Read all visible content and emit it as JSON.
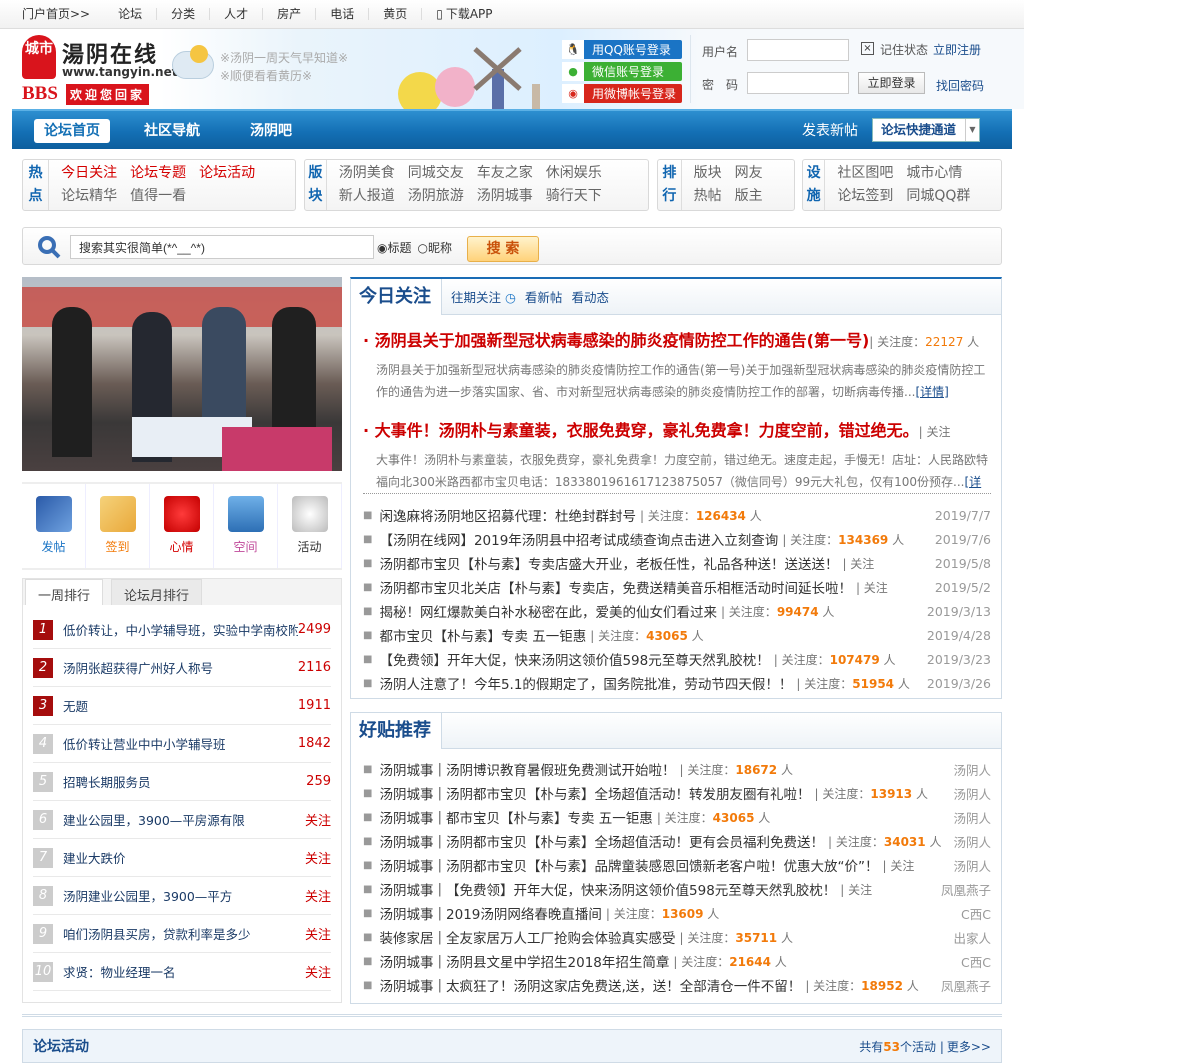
{
  "topbar": {
    "items": [
      "门户首页>>",
      "论坛",
      "分类",
      "人才",
      "房产",
      "电话",
      "黄页",
      "下载APP"
    ]
  },
  "header": {
    "logo": {
      "badge": "城市",
      "name": "湯阴在线",
      "url": "www.tangyin.net",
      "bbs": "BBS",
      "welcome": "欢迎您回家"
    },
    "weather": [
      "※汤阴一周天气早知道※",
      "※顺便看看黄历※"
    ],
    "social": [
      {
        "label": "用QQ账号登录",
        "color": "#1a74c5"
      },
      {
        "label": "微信账号登录",
        "color": "#3cb034"
      },
      {
        "label": "用微博帐号登录",
        "color": "#d7261b"
      }
    ],
    "login": {
      "username_label": "用户名",
      "password_label": "密　码",
      "username_value": "",
      "password_value": "",
      "remember": "记住状态",
      "register": "立即注册",
      "login_button": "立即登录",
      "forgot": "找回密码"
    }
  },
  "nav": {
    "items": [
      "论坛首页",
      "社区导航",
      "汤阴吧"
    ],
    "post": "发表新帖",
    "quick": "论坛快捷通道"
  },
  "quick": [
    {
      "head": [
        "热",
        "点"
      ],
      "links": [
        {
          "t": "今日关注",
          "red": true
        },
        {
          "t": "论坛专题",
          "red": true
        },
        {
          "t": "论坛活动",
          "red": true
        },
        {
          "t": "论坛精华"
        },
        {
          "t": "值得一看"
        }
      ]
    },
    {
      "head": [
        "版",
        "块"
      ],
      "links": [
        {
          "t": "汤阴美食"
        },
        {
          "t": "同城交友"
        },
        {
          "t": "车友之家"
        },
        {
          "t": "休闲娱乐"
        },
        {
          "t": "新人报道"
        },
        {
          "t": "汤阴旅游"
        },
        {
          "t": "汤阴城事"
        },
        {
          "t": "骑行天下"
        }
      ]
    },
    {
      "head": [
        "排",
        "行"
      ],
      "links": [
        {
          "t": "版块"
        },
        {
          "t": "网友"
        },
        {
          "t": "热帖"
        },
        {
          "t": "版主"
        }
      ]
    },
    {
      "head": [
        "设",
        "施"
      ],
      "links": [
        {
          "t": "社区图吧"
        },
        {
          "t": "城市心情"
        },
        {
          "t": "论坛签到"
        },
        {
          "t": "同城QQ群"
        }
      ]
    }
  ],
  "search": {
    "value": "搜索其实很简单(*^__^*)",
    "options": [
      "标题",
      "昵称"
    ],
    "selected": "标题",
    "button": "搜 索"
  },
  "icons": [
    {
      "label": "发帖",
      "color": "#1a74c5"
    },
    {
      "label": "签到",
      "color": "#f27a0a"
    },
    {
      "label": "心情",
      "color": "#d40000"
    },
    {
      "label": "空间",
      "color": "#c04a9a"
    },
    {
      "label": "活动",
      "color": "#333"
    }
  ],
  "ranking": {
    "tabs": [
      "一周排行",
      "论坛月排行"
    ],
    "items": [
      {
        "n": "1",
        "t": "低价转让，中小学辅导班，实验中学南校附",
        "v": "2499"
      },
      {
        "n": "2",
        "t": "汤阴张超获得广州好人称号",
        "v": "2116"
      },
      {
        "n": "3",
        "t": "无题",
        "v": "1911"
      },
      {
        "n": "4",
        "t": "低价转让营业中中小学辅导班",
        "v": "1842"
      },
      {
        "n": "5",
        "t": "招聘长期服务员",
        "v": "259"
      },
      {
        "n": "6",
        "t": "建业公园里，3900—平房源有限",
        "v": "关注"
      },
      {
        "n": "7",
        "t": "建业大跌价",
        "v": "关注"
      },
      {
        "n": "8",
        "t": "汤阴建业公园里，3900—平方",
        "v": "关注"
      },
      {
        "n": "9",
        "t": "咱们汤阴县买房，贷款利率是多少",
        "v": "关注"
      },
      {
        "n": "10",
        "t": "求贤：物业经理一名",
        "v": "关注"
      }
    ]
  },
  "today": {
    "title": "今日关注",
    "links": [
      "往期关注",
      "看新帖",
      "看动态"
    ],
    "headlines": [
      {
        "t": "汤阴县关于加强新型冠状病毒感染的肺炎疫情防控工作的通告(第一号)",
        "meta": "| 关注度：",
        "count": "22127",
        "unit": " 人",
        "desc": "汤阴县关于加强新型冠状病毒感染的肺炎疫情防控工作的通告(第一号)关于加强新型冠状病毒感染的肺炎疫情防控工作的通告为进一步落实国家、省、市对新型冠状病毒感染的肺炎疫情防控工作的部署，切断病毒传播...",
        "more": "[详情]"
      },
      {
        "t": "大事件！汤阴朴与素童装，衣服免费穿，豪礼免费拿！力度空前，错过绝无。",
        "meta": "| 关注",
        "count": "",
        "unit": "",
        "desc": "大事件！汤阴朴与素童装，衣服免费穿，豪礼免费拿！力度空前，错过绝无。速度走起，手慢无！店址：人民路欧特福向北300米路西都市宝贝电话：18338019616171238750​57（微信同号）99元大礼包，仅有100份预存...",
        "more": "[详"
      }
    ],
    "list": [
      {
        "t": "闲逸麻将汤阴地区招募代理：杜绝封群封号",
        "meta": "| 关注度：",
        "count": "126434",
        "unit": " 人",
        "date": "2019/7/7"
      },
      {
        "t": "【汤阴在线网】2019年汤阴县中招考试成绩查询点击进入立刻查询",
        "meta": "| 关注度：",
        "count": "134369",
        "unit": " 人",
        "date": "2019/7/6"
      },
      {
        "t": "汤阴都市宝贝【朴与素】专卖店盛大开业，老板任性，礼品各种送！送送送！",
        "meta": "| 关注",
        "count": "",
        "unit": "",
        "date": "2019/5/8"
      },
      {
        "t": "汤阴都市宝贝北关店【朴与素】专卖店，免费送精美音乐相框活动时间延长啦！",
        "meta": "| 关注",
        "count": "",
        "unit": "",
        "date": "2019/5/2"
      },
      {
        "t": "揭秘！网红爆款美白补水秘密在此，爱美的仙女们看过来",
        "meta": "| 关注度：",
        "count": "99474",
        "unit": " 人",
        "date": "2019/3/13"
      },
      {
        "t": "都市宝贝【朴与素】专卖 五一钜惠",
        "meta": "| 关注度：",
        "count": "43065",
        "unit": " 人",
        "date": "2019/4/28"
      },
      {
        "t": "【免费领】开年大促，快来汤阴这领价值598元至尊天然乳胶枕！",
        "meta": "| 关注度：",
        "count": "107479",
        "unit": " 人",
        "date": "2019/3/23"
      },
      {
        "t": "汤阴人注意了！今年5.1的假期定了，国务院批准，劳动节四天假！！",
        "meta": "| 关注度：",
        "count": "51954",
        "unit": " 人",
        "date": "2019/3/26"
      }
    ]
  },
  "recommend": {
    "title": "好贴推荐",
    "list": [
      {
        "cat": "汤阴城事",
        "t": "汤阴博识教育暑假班免费测试开始啦！",
        "meta": "| 关注度：",
        "count": "18672",
        "unit": " 人",
        "author": "汤阴人"
      },
      {
        "cat": "汤阴城事",
        "t": "汤阴都市宝贝【朴与素】全场超值活动！转发朋友圈有礼啦！",
        "meta": "| 关注度：",
        "count": "13913",
        "unit": " 人",
        "author": "汤阴人"
      },
      {
        "cat": "汤阴城事",
        "t": "都市宝贝【朴与素】专卖 五一钜惠",
        "meta": "| 关注度：",
        "count": "43065",
        "unit": " 人",
        "author": "汤阴人"
      },
      {
        "cat": "汤阴城事",
        "t": "汤阴都市宝贝【朴与素】全场超值活动！更有会员福利免费送！",
        "meta": "| 关注度：",
        "count": "34031",
        "unit": " 人",
        "author": "汤阴人"
      },
      {
        "cat": "汤阴城事",
        "t": "汤阴都市宝贝【朴与素】品牌童装感恩回馈新老客户啦！优惠大放“价”！",
        "meta": "| 关注",
        "count": "",
        "unit": "",
        "author": "汤阴人"
      },
      {
        "cat": "汤阴城事",
        "t": "【免费领】开年大促，快来汤阴这领价值598元至尊天然乳胶枕！",
        "meta": "| 关注",
        "count": "",
        "unit": "",
        "author": "凤凰燕子"
      },
      {
        "cat": "汤阴城事",
        "t": "2019汤阴网络春晚直播间",
        "meta": "| 关注度：",
        "count": "13609",
        "unit": " 人",
        "author": "C西C"
      },
      {
        "cat": "装修家居",
        "t": "全友家居万人工厂抢购会体验真实感受",
        "meta": "| 关注度：",
        "count": "35711",
        "unit": " 人",
        "author": "出家人"
      },
      {
        "cat": "汤阴城事",
        "t": "汤阴县文星中学招生2018年招生简章",
        "meta": "| 关注度：",
        "count": "21644",
        "unit": " 人",
        "author": "C西C"
      },
      {
        "cat": "汤阴城事",
        "t": "太疯狂了！汤阴这家店免费送,送，送！全部清仓一件不留！",
        "meta": "| 关注度：",
        "count": "18952",
        "unit": " 人",
        "author": "凤凰燕子"
      }
    ]
  },
  "activity": {
    "title": "论坛活动",
    "prefix": "共有",
    "count": "53",
    "suffix": "个活动",
    "more": "更多>>"
  }
}
